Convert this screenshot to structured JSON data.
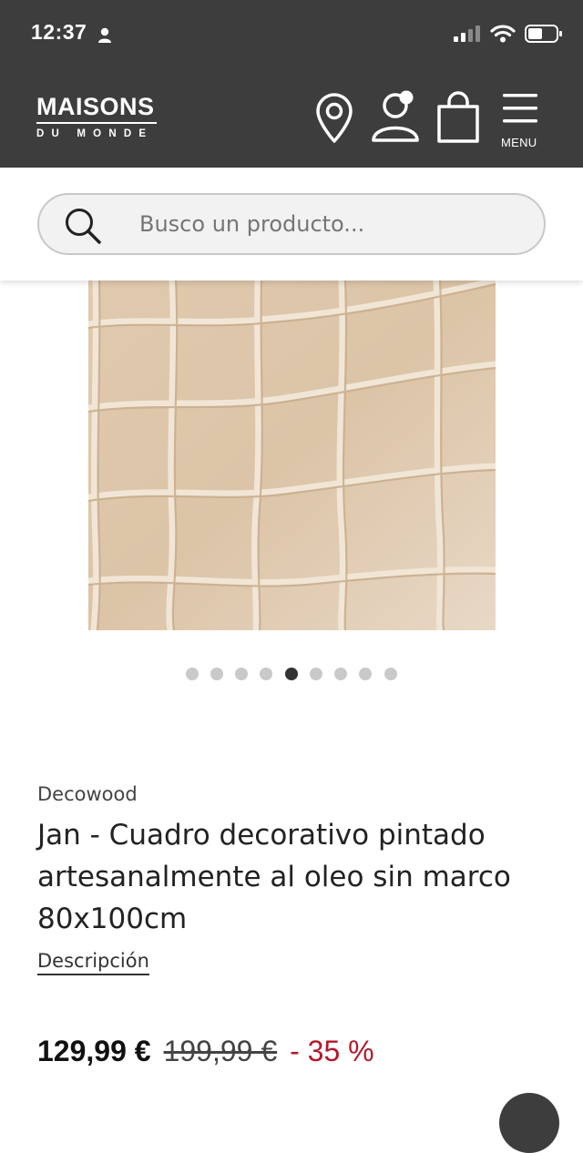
{
  "status_bar": {
    "time": "12:37"
  },
  "header": {
    "logo_top": "MAISONS",
    "logo_bottom": "DU MONDE",
    "menu_label": "MENU"
  },
  "search": {
    "placeholder": "Busco un producto..."
  },
  "gallery": {
    "image_count": 9,
    "active_index": 4
  },
  "product": {
    "brand": "Decowood",
    "title": "Jan - Cuadro decorativo pintado artesanalmente al oleo sin marco 80x100cm",
    "description_link": "Descripción",
    "price_current": "129,99 €",
    "price_original": "199,99 €",
    "discount": "- 35 %"
  },
  "colors": {
    "header_bg": "#3d3d3d",
    "discount_red": "#b3192b",
    "canvas": "#d9c3a8"
  }
}
